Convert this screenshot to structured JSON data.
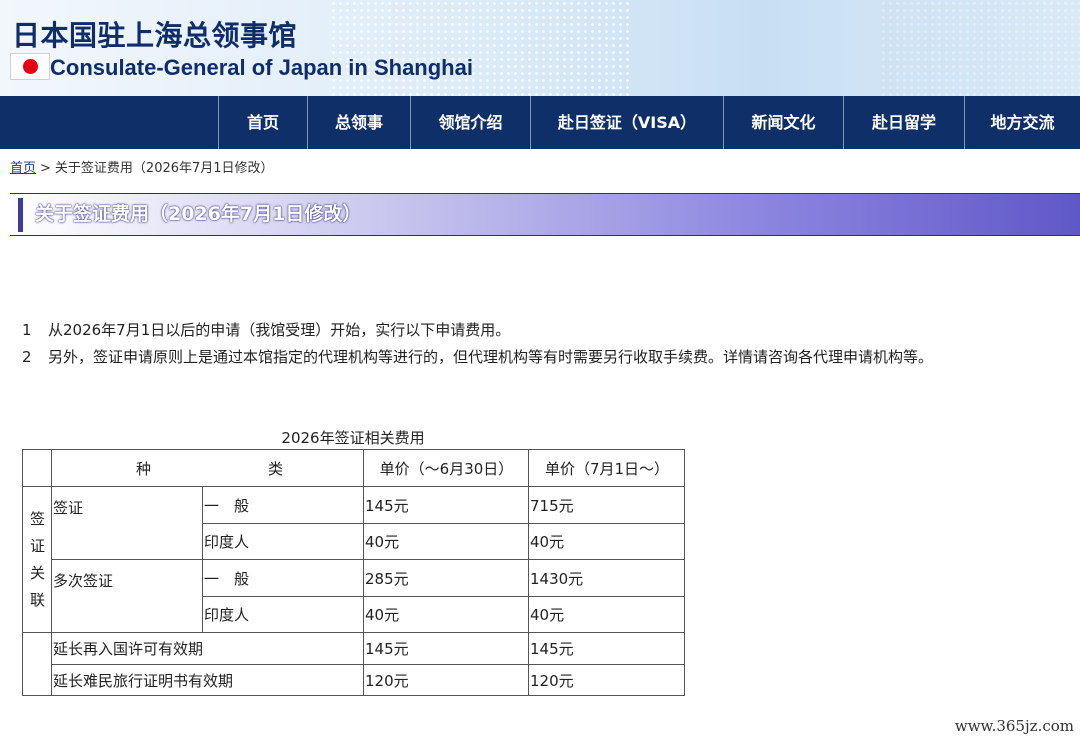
{
  "header": {
    "title_cn": "日本国驻上海总领事馆",
    "title_en": "Consulate-General of Japan in Shanghai"
  },
  "nav": [
    {
      "label": "首页"
    },
    {
      "label": "总领事"
    },
    {
      "label": "领馆介绍"
    },
    {
      "label": "赴日签证（VISA）"
    },
    {
      "label": "新闻文化"
    },
    {
      "label": "赴日留学"
    },
    {
      "label": "地方交流"
    }
  ],
  "breadcrumb": {
    "home": "首页",
    "separator": ">",
    "current": "关于签证费用（2026年7月1日修改）"
  },
  "page_title": "关于签证费用（2026年7月1日修改）",
  "notes": [
    {
      "num": "1",
      "text": "从2026年7月1日以后的申请（我馆受理）开始，实行以下申请费用。"
    },
    {
      "num": "2",
      "text": "另外，签证申请原则上是通过本馆指定的代理机构等进行的，但代理机构等有时需要另行收取手续费。详情请咨询各代理申请机构等。"
    }
  ],
  "fee_table": {
    "caption": "2026年签证相关费用",
    "header": {
      "type_left": "种",
      "type_right": "类",
      "price_old": "单价（～6月30日）",
      "price_new": "单价（7月1日～）"
    },
    "group_label": [
      "签",
      "证",
      "关",
      "联"
    ],
    "visa": {
      "label": "签证",
      "general": {
        "label": "一　般",
        "old": "145元",
        "new": "715元"
      },
      "indian": {
        "label": "印度人",
        "old": "40元",
        "new": "40元"
      }
    },
    "multi_visa": {
      "label": "多次签证",
      "general": {
        "label": "一　般",
        "old": "285元",
        "new": "1430元"
      },
      "indian": {
        "label": "印度人",
        "old": "40元",
        "new": "40元"
      }
    },
    "reentry": {
      "label": "延长再入国许可有效期",
      "old": "145元",
      "new": "145元"
    },
    "refugee": {
      "label": "延长难民旅行证明书有效期",
      "old": "120元",
      "new": "120元"
    }
  },
  "watermark": "www.365jz.com",
  "colors": {
    "nav_bg": "#0f2f68",
    "title_text": "#0f2d6b",
    "flag_red": "#e60012",
    "title_bar_end": "#5f58c8"
  }
}
